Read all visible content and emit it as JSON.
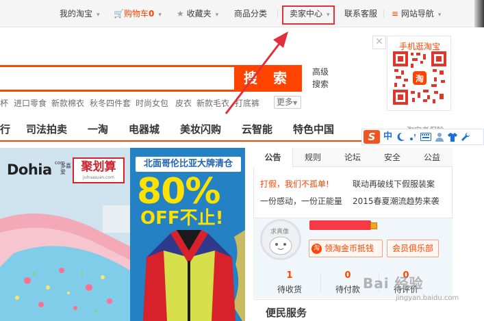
{
  "topbar": {
    "my_taobao": "我的淘宝",
    "cart_label": "购物车",
    "cart_count": "0",
    "favorites": "收藏夹",
    "categories": "商品分类",
    "seller_center": "卖家中心",
    "customer_service": "联系客服",
    "site_nav": "网站导航"
  },
  "qr": {
    "title": "手机逛淘宝",
    "center_char": "淘"
  },
  "search": {
    "button_label": "搜 索",
    "advanced_label": "高级搜索",
    "input_value": ""
  },
  "hotwords": [
    "杯",
    "进口零食",
    "新款棉衣",
    "秋冬四件套",
    "时尚女包",
    "皮衣",
    "新款毛衣",
    "打底裤"
  ],
  "more_label": "更多",
  "nav": [
    "行",
    "司法拍卖",
    "一淘",
    "电器城",
    "美妆闪购",
    "云智能",
    "特色中国",
    "淘宝老保险"
  ],
  "ime": {
    "logo": "S",
    "lang": "中",
    "icons": [
      "moon-icon",
      "punctuation-icon",
      "keyboard-icon",
      "user-icon",
      "shirt-icon",
      "wrench-icon"
    ]
  },
  "banner1": {
    "brand": "Dohia",
    "brand_suffix": "com",
    "brand_tag": "多喜爱",
    "promo_name": "聚划算",
    "promo_url": "juhuasuan.com"
  },
  "banner2": {
    "title": "北面哥伦比亚大牌清仓",
    "discount": "80%",
    "off_text": "OFF不止!"
  },
  "notice": {
    "tabs": [
      "公告",
      "规则",
      "论坛",
      "安全",
      "公益"
    ],
    "news": [
      {
        "text": "打假，我们不孤单!",
        "highlight": true
      },
      {
        "text": "联动再破线下假服装案",
        "highlight": false
      },
      {
        "text": "一份感动，一份正能量",
        "highlight": false
      },
      {
        "text": "2015春夏潮流趋势来袭",
        "highlight": false
      }
    ]
  },
  "user": {
    "avatar_label": "求真像",
    "coin_button": "领淘金币抵钱",
    "coin_icon": "淘",
    "club_button": "会员俱乐部",
    "stats": [
      {
        "count": "1",
        "label": "待收货"
      },
      {
        "count": "0",
        "label": "待付款"
      },
      {
        "count": "0",
        "label": "待评价"
      }
    ]
  },
  "service": {
    "title": "便民服务"
  },
  "watermark": {
    "text": "Bai 经验",
    "url": "jingyan.baidu.com"
  },
  "colors": {
    "accent": "#ff4400",
    "highlight_box": "#e0303a",
    "banner2_bg": "#2481c4",
    "discount_yellow": "#fde100"
  }
}
